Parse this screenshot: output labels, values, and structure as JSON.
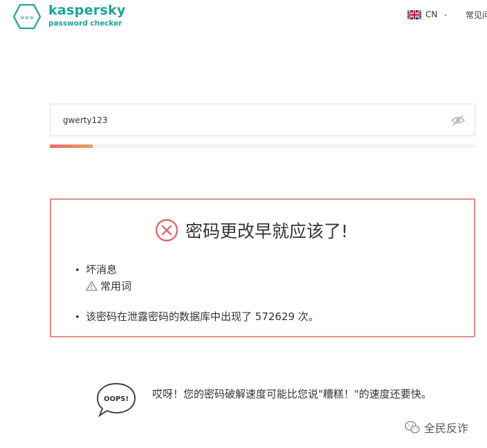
{
  "header": {
    "logo_name": "kaspersky",
    "logo_sub": "password checker",
    "language": "CN",
    "faq_label": "常见问"
  },
  "password_field": {
    "value": "gwerty123",
    "strength_fraction": 0.1
  },
  "result": {
    "title": "密码更改早就应该了!",
    "bad_news_label": "坏消息",
    "common_word_label": "常用词",
    "breach_text": "该密码在泄露密码的数据库中出现了 572629 次。"
  },
  "oops": {
    "badge_text": "OOPS!",
    "message": "哎呀！您的密码破解速度可能比您说\"糟糕！\"的速度还要快。"
  },
  "watermark": {
    "text": "全民反诈"
  },
  "colors": {
    "brand": "#1aa594",
    "error_border": "#e58a8a",
    "error_icon": "#e06a6a",
    "strength_start": "#e2706b",
    "strength_end": "#e8a066"
  }
}
